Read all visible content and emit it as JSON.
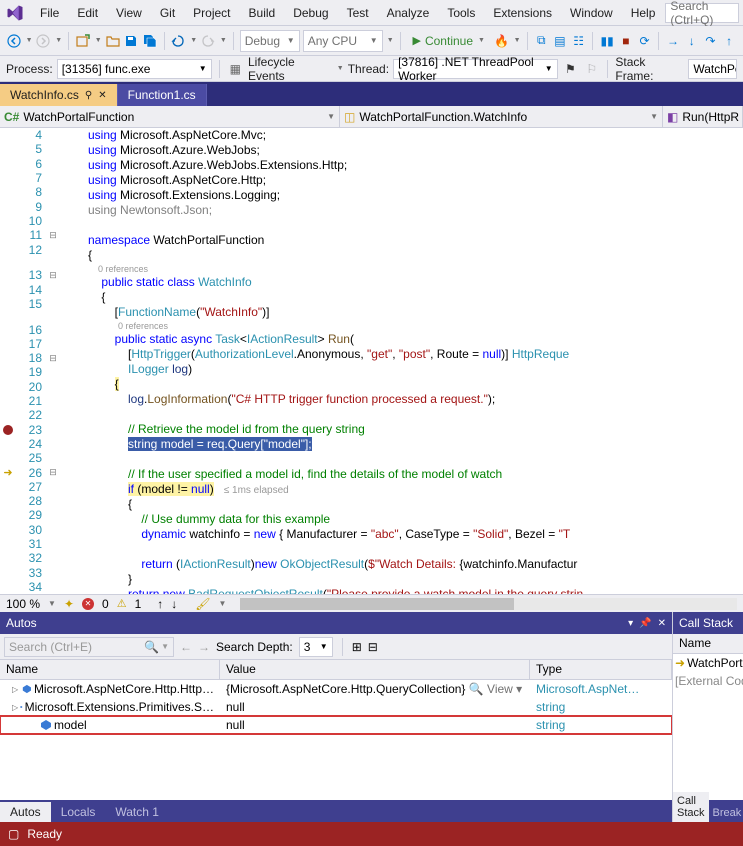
{
  "menu": {
    "items": [
      "File",
      "Edit",
      "View",
      "Git",
      "Project",
      "Build",
      "Debug",
      "Test",
      "Analyze",
      "Tools",
      "Extensions",
      "Window",
      "Help"
    ],
    "search_placeholder": "Search (Ctrl+Q)"
  },
  "toolbar": {
    "config": "Debug",
    "platform": "Any CPU",
    "continue": "Continue"
  },
  "debugbar": {
    "process_label": "Process:",
    "process_value": "[31356] func.exe",
    "lc": "Lifecycle Events",
    "thread_label": "Thread:",
    "thread_value": "[37816] .NET ThreadPool Worker",
    "stack_label": "Stack Frame:",
    "stack_value": "WatchPo"
  },
  "tabs": {
    "active": "WatchInfo.cs",
    "other": "Function1.cs"
  },
  "nav": {
    "left": "WatchPortalFunction",
    "mid": "WatchPortalFunction.WatchInfo",
    "right": "Run(HttpR"
  },
  "code": {
    "lines": [
      {
        "n": 4,
        "html": "<span class='c-kw'>using</span> Microsoft.AspNetCore.Mvc;"
      },
      {
        "n": 5,
        "html": "<span class='c-kw'>using</span> Microsoft.Azure.WebJobs;"
      },
      {
        "n": 6,
        "html": "<span class='c-kw'>using</span> Microsoft.Azure.WebJobs.Extensions.Http;"
      },
      {
        "n": 7,
        "html": "<span class='c-kw'>using</span> Microsoft.AspNetCore.Http;"
      },
      {
        "n": 8,
        "html": "<span class='c-kw'>using</span> Microsoft.Extensions.Logging;"
      },
      {
        "n": 9,
        "html": "<span class='c-gray'>using Newtonsoft.Json;</span>"
      },
      {
        "n": 10,
        "html": ""
      },
      {
        "n": 11,
        "fold": "⊟",
        "html": "<span class='c-kw'>namespace</span> WatchPortalFunction"
      },
      {
        "n": 12,
        "html": "{"
      },
      {
        "ref": "0 references"
      },
      {
        "n": 13,
        "fold": "⊟",
        "html": "    <span class='c-kw'>public</span> <span class='c-kw'>static</span> <span class='c-kw'>class</span> <span class='c-type'>WatchInfo</span>"
      },
      {
        "n": 14,
        "html": "    {"
      },
      {
        "n": 15,
        "html": "        [<span class='c-type'>FunctionName</span>(<span class='c-str'>\"WatchInfo\"</span>)]"
      },
      {
        "ref": "        0 references"
      },
      {
        "n": 16,
        "html": "        <span class='c-kw'>public</span> <span class='c-kw'>static</span> <span class='c-kw'>async</span> <span class='c-type'>Task</span>&lt;<span class='c-type'>IActionResult</span>&gt; <span class='c-method'>Run</span>("
      },
      {
        "n": 17,
        "html": "            [<span class='c-type'>HttpTrigger</span>(<span class='c-type'>AuthorizationLevel</span>.Anonymous, <span class='c-str'>\"get\"</span>, <span class='c-str'>\"post\"</span>, Route = <span class='c-kw'>null</span>)] <span class='c-type'>HttpReque</span>"
      },
      {
        "n": 18,
        "fold": "⊟",
        "html": "            <span class='c-type'>ILogger</span> <span class='c-param'>log</span>)"
      },
      {
        "n": 19,
        "html": "        <span class='highlight-yellow'>{</span>",
        "chg": true
      },
      {
        "n": 20,
        "html": "            <span class='c-param'>log</span>.<span class='c-method'>LogInformation</span>(<span class='c-str'>\"C# HTTP trigger function processed a request.\"</span>);",
        "chg": true
      },
      {
        "n": 21,
        "html": "",
        "chg": true
      },
      {
        "n": 22,
        "html": "            <span class='c-com'>// Retrieve the model id from the query string</span>",
        "chg": true
      },
      {
        "n": 23,
        "bp": true,
        "html": "            <span class='highlight-sel'><span class='c-kw'>string</span> model = req.Query[<span class='c-str'>\"model\"</span>];</span>",
        "chg": true
      },
      {
        "n": 24,
        "html": "",
        "chg": true
      },
      {
        "n": 25,
        "html": "            <span class='c-com'>// If the user specified a model id, find the details of the model of watch</span>",
        "chg": true
      },
      {
        "n": 26,
        "cur": true,
        "fold": "⊟",
        "html": "            <span class='highlight-yellow'><span class='c-kw'>if</span> (model != <span class='c-kw'>null</span>)</span>   <span class='elapsed'>≤ 1ms elapsed</span>",
        "chg": true
      },
      {
        "n": 27,
        "html": "            {",
        "chg": true
      },
      {
        "n": 28,
        "html": "                <span class='c-com'>// Use dummy data for this example</span>",
        "chg": true
      },
      {
        "n": 29,
        "html": "                <span class='c-kw'>dynamic</span> watchinfo = <span class='c-kw'>new</span> { Manufacturer = <span class='c-str'>\"abc\"</span>, CaseType = <span class='c-str'>\"Solid\"</span>, Bezel = <span class='c-str'>\"T</span>",
        "chg": true
      },
      {
        "n": 30,
        "html": "",
        "chg": true
      },
      {
        "n": 31,
        "html": "                <span class='c-kw'>return</span> (<span class='c-type'>IActionResult</span>)<span class='c-kw'>new</span> <span class='c-type'>OkObjectResult</span>(<span class='c-str'>$\"Watch Details: </span>{watchinfo.Manufactur",
        "chg": true
      },
      {
        "n": 32,
        "html": "            }",
        "chg": true
      },
      {
        "n": 33,
        "html": "            <span class='c-kw'>return</span> <span class='c-kw'>new</span> <span class='c-type'>BadRequestObjectResult</span>(<span class='c-str'>\"Please provide a watch model in the query strin</span>",
        "chg": true
      },
      {
        "n": 34,
        "html": "        }"
      }
    ]
  },
  "zoom": {
    "value": "100 %",
    "errors": "0",
    "warnings": "1"
  },
  "autos": {
    "title": "Autos",
    "search_placeholder": "Search (Ctrl+E)",
    "depth_label": "Search Depth:",
    "depth_value": "3",
    "cols": {
      "name": "Name",
      "value": "Value",
      "type": "Type"
    },
    "rows": [
      {
        "indent": 0,
        "exp": "▷",
        "icon": "#3a7bd5",
        "name": "Microsoft.AspNetCore.Http.Http…",
        "value": "{Microsoft.AspNetCore.Http.QueryCollection}",
        "view": "View",
        "type": "Microsoft.AspNet…"
      },
      {
        "indent": 0,
        "exp": "▷",
        "icon": "#3a7bd5",
        "name": "Microsoft.Extensions.Primitives.S…",
        "value": "null",
        "type": "string"
      },
      {
        "indent": 1,
        "exp": "",
        "icon": "#3a7bd5",
        "name": "model",
        "value": "null",
        "type": "string",
        "hl": true
      }
    ],
    "tabs": [
      "Autos",
      "Locals",
      "Watch 1"
    ]
  },
  "callstack": {
    "title": "Call Stack",
    "col": "Name",
    "rows": [
      {
        "cur": true,
        "text": "WatchPortalFu"
      },
      {
        "cur": false,
        "text": "[External Code"
      }
    ],
    "tabs": [
      "Call Stack",
      "Break"
    ]
  },
  "status": {
    "text": "Ready"
  }
}
